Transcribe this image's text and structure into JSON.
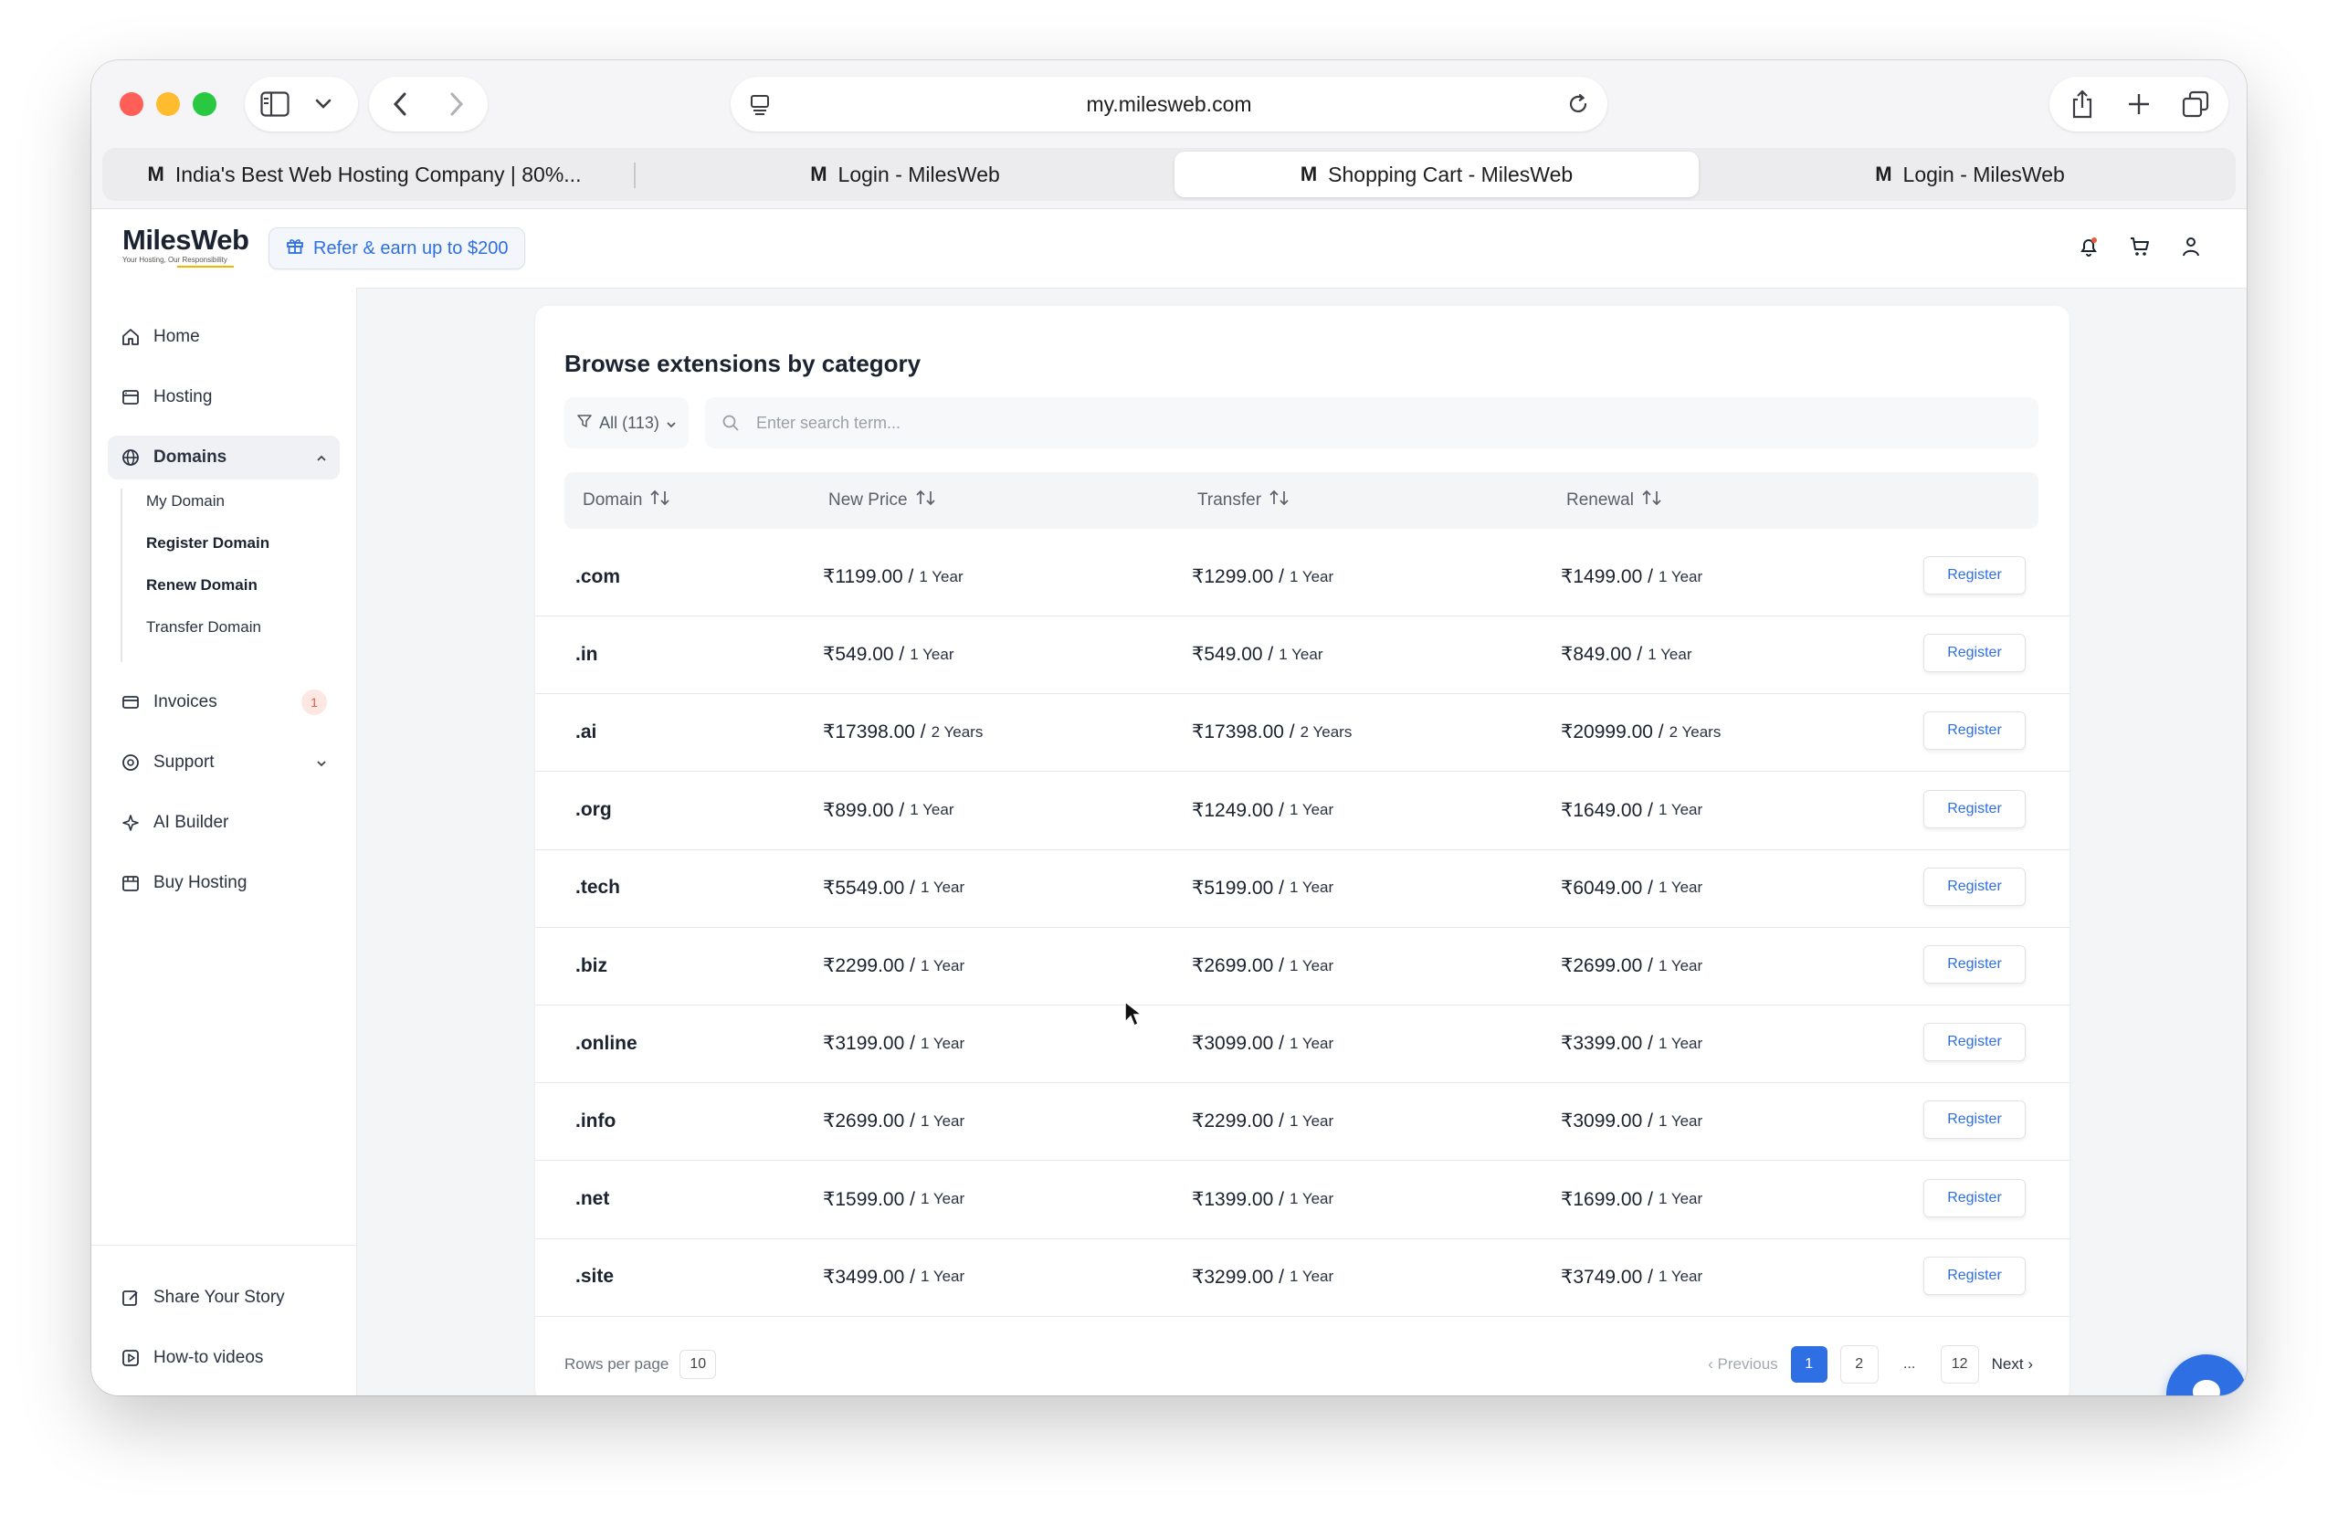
{
  "browser": {
    "url": "my.milesweb.com",
    "tabs": [
      {
        "label": "India's Best Web Hosting Company | 80%...",
        "favicon": "M",
        "active": false
      },
      {
        "label": "Login - MilesWeb",
        "favicon": "M",
        "active": false
      },
      {
        "label": "Shopping Cart - MilesWeb",
        "favicon": "M",
        "active": true
      },
      {
        "label": "Login - MilesWeb",
        "favicon": "M",
        "active": false
      }
    ]
  },
  "header": {
    "logo": "MilesWeb",
    "logo_tagline": "Your Hosting, Our Responsibility",
    "refer_label": "Refer & earn up to $200"
  },
  "sidebar": {
    "items": [
      {
        "label": "Home",
        "icon": "home-icon"
      },
      {
        "label": "Hosting",
        "icon": "hosting-icon"
      },
      {
        "label": "Domains",
        "icon": "globe-icon",
        "active": true
      },
      {
        "label": "Invoices",
        "icon": "invoice-icon",
        "badge": "1"
      },
      {
        "label": "Support",
        "icon": "support-icon"
      },
      {
        "label": "AI Builder",
        "icon": "sparkle-icon"
      },
      {
        "label": "Buy Hosting",
        "icon": "store-icon"
      }
    ],
    "domain_sub": [
      "My Domain",
      "Register Domain",
      "Renew Domain",
      "Transfer Domain"
    ],
    "bottom": [
      {
        "label": "Share Your Story",
        "icon": "edit-icon"
      },
      {
        "label": "How-to videos",
        "icon": "play-icon"
      }
    ]
  },
  "main": {
    "title": "Browse extensions by category",
    "filter_label": "All (113)",
    "search_placeholder": "Enter search term...",
    "columns": [
      "Domain",
      "New Price",
      "Transfer",
      "Renewal"
    ],
    "register_label": "Register",
    "rows": [
      {
        "ext": ".com",
        "new": "₹1199.00 /",
        "new_per": "1 Year",
        "transfer": "₹1299.00 /",
        "transfer_per": "1 Year",
        "renewal": "₹1499.00 /",
        "renewal_per": "1 Year"
      },
      {
        "ext": ".in",
        "new": "₹549.00 /",
        "new_per": "1 Year",
        "transfer": "₹549.00 /",
        "transfer_per": "1 Year",
        "renewal": "₹849.00 /",
        "renewal_per": "1 Year"
      },
      {
        "ext": ".ai",
        "new": "₹17398.00 /",
        "new_per": "2 Years",
        "transfer": "₹17398.00 /",
        "transfer_per": "2 Years",
        "renewal": "₹20999.00 /",
        "renewal_per": "2 Years"
      },
      {
        "ext": ".org",
        "new": "₹899.00 /",
        "new_per": "1 Year",
        "transfer": "₹1249.00 /",
        "transfer_per": "1 Year",
        "renewal": "₹1649.00 /",
        "renewal_per": "1 Year"
      },
      {
        "ext": ".tech",
        "new": "₹5549.00 /",
        "new_per": "1 Year",
        "transfer": "₹5199.00 /",
        "transfer_per": "1 Year",
        "renewal": "₹6049.00 /",
        "renewal_per": "1 Year"
      },
      {
        "ext": ".biz",
        "new": "₹2299.00 /",
        "new_per": "1 Year",
        "transfer": "₹2699.00 /",
        "transfer_per": "1 Year",
        "renewal": "₹2699.00 /",
        "renewal_per": "1 Year"
      },
      {
        "ext": ".online",
        "new": "₹3199.00 /",
        "new_per": "1 Year",
        "transfer": "₹3099.00 /",
        "transfer_per": "1 Year",
        "renewal": "₹3399.00 /",
        "renewal_per": "1 Year"
      },
      {
        "ext": ".info",
        "new": "₹2699.00 /",
        "new_per": "1 Year",
        "transfer": "₹2299.00 /",
        "transfer_per": "1 Year",
        "renewal": "₹3099.00 /",
        "renewal_per": "1 Year"
      },
      {
        "ext": ".net",
        "new": "₹1599.00 /",
        "new_per": "1 Year",
        "transfer": "₹1399.00 /",
        "transfer_per": "1 Year",
        "renewal": "₹1699.00 /",
        "renewal_per": "1 Year"
      },
      {
        "ext": ".site",
        "new": "₹3499.00 /",
        "new_per": "1 Year",
        "transfer": "₹3299.00 /",
        "transfer_per": "1 Year",
        "renewal": "₹3749.00 /",
        "renewal_per": "1 Year"
      }
    ],
    "rows_per_page_label": "Rows per page",
    "rows_per_page": "10",
    "pagination": {
      "prev": "‹ Previous",
      "pages": [
        "1",
        "2",
        "...",
        "12"
      ],
      "current": "1",
      "next": "Next ›"
    }
  },
  "colors": {
    "accent": "#2f6fe4",
    "badge": "#e35d3f"
  }
}
